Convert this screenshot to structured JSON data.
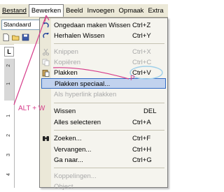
{
  "menubar": {
    "items": [
      "Bestand",
      "Bewerken",
      "Beeld",
      "Invoegen",
      "Opmaak",
      "Extra"
    ],
    "active_index": 1
  },
  "toolbar": {
    "style_value": "Standaard"
  },
  "ruler": {
    "corner_label": "L",
    "numbers": [
      "2",
      "1",
      "1",
      "2",
      "3",
      "4"
    ]
  },
  "menu": {
    "items": [
      {
        "label": "Ongedaan maken Wissen",
        "shortcut": "Ctrl+Z",
        "icon": "undo-icon",
        "enabled": true
      },
      {
        "label": "Herhalen Wissen",
        "shortcut": "Ctrl+Y",
        "icon": "redo-icon",
        "enabled": true
      },
      {
        "label": "Knippen",
        "shortcut": "Ctrl+X",
        "icon": "scissors-icon",
        "enabled": false
      },
      {
        "label": "Kopiëren",
        "shortcut": "Ctrl+C",
        "icon": "copy-icon",
        "enabled": false
      },
      {
        "label": "Plakken",
        "shortcut": "Ctrl+V",
        "icon": "paste-icon",
        "enabled": true
      },
      {
        "label": "Plakken speciaal...",
        "shortcut": "",
        "icon": "",
        "enabled": true,
        "highlighted": true
      },
      {
        "label": "Als hyperlink plakken",
        "shortcut": "",
        "icon": "",
        "enabled": false
      },
      {
        "label": "Wissen",
        "shortcut": "DEL",
        "icon": "",
        "enabled": true
      },
      {
        "label": "Alles selecteren",
        "shortcut": "Ctrl+A",
        "icon": "",
        "enabled": true
      },
      {
        "label": "Zoeken...",
        "shortcut": "Ctrl+F",
        "icon": "binoculars-icon",
        "enabled": true
      },
      {
        "label": "Vervangen...",
        "shortcut": "Ctrl+H",
        "icon": "",
        "enabled": true
      },
      {
        "label": "Ga naar...",
        "shortcut": "Ctrl+G",
        "icon": "",
        "enabled": true
      },
      {
        "label": "Koppelingen...",
        "shortcut": "",
        "icon": "",
        "enabled": false
      },
      {
        "label": "Object",
        "shortcut": "",
        "icon": "",
        "enabled": false
      }
    ]
  },
  "annotations": {
    "alt_w": "ALT + W",
    "p_key": "P",
    "color": "#d63b8a"
  }
}
